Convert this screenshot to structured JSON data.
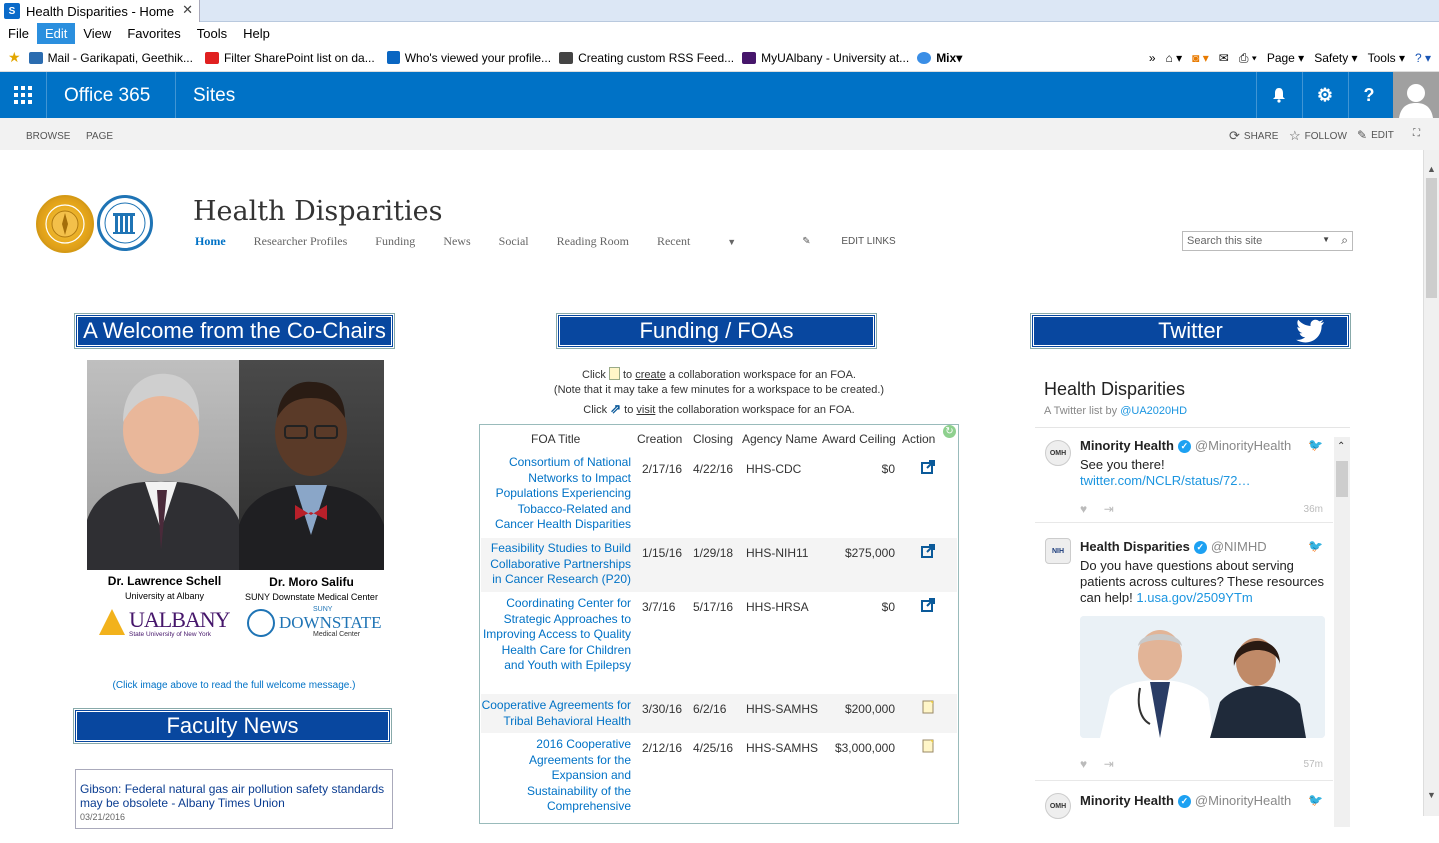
{
  "browser": {
    "tab_title": "Health Disparities - Home",
    "tab_close": "✕",
    "menu": [
      "File",
      "Edit",
      "View",
      "Favorites",
      "Tools",
      "Help"
    ],
    "favorites": [
      {
        "label": "Mail - Garikapati, Geethik...",
        "color": "#2b6cb0"
      },
      {
        "label": "Filter SharePoint list on da...",
        "color": "#e02020"
      },
      {
        "label": "Who's viewed your profile...",
        "color": "#0a66c2"
      },
      {
        "label": "Creating custom RSS Feed...",
        "color": "#444444"
      },
      {
        "label": "MyUAlbany - University at...",
        "color": "#46166b"
      },
      {
        "label": "Mix",
        "color": "#3a8ee6"
      }
    ],
    "tools": {
      "page": "Page ▾",
      "safety": "Safety ▾",
      "tools": "Tools ▾",
      "help": "? ▾"
    }
  },
  "suite": {
    "brand": "Office 365",
    "sites": "Sites"
  },
  "ribbon": {
    "browse": "BROWSE",
    "page": "PAGE",
    "share": "SHARE",
    "follow": "FOLLOW",
    "edit": "EDIT"
  },
  "site": {
    "title": "Health Disparities",
    "nav": [
      "Home",
      "Researcher Profiles",
      "Funding",
      "News",
      "Social",
      "Reading Room",
      "Recent"
    ],
    "edit_links": "EDIT LINKS",
    "search_placeholder": "Search this site"
  },
  "welcome": {
    "header": "A Welcome from the Co-Chairs",
    "person1_name": "Dr. Lawrence Schell",
    "person1_aff": "University at Albany",
    "person2_name": "Dr. Moro Salifu",
    "person2_aff": "SUNY Downstate Medical Center",
    "logo1": "UALBANY",
    "logo1_sub": "State University of New York",
    "logo2_top": "SUNY",
    "logo2": "DOWNSTATE",
    "logo2_sub": "Medical Center",
    "note": "(Click image above to read the full welcome message.)"
  },
  "faculty_news": {
    "header": "Faculty News",
    "item1": "Gibson: Federal natural gas air pollution safety standards may be obsolete - Albany Times Union",
    "item1_date": "03/21/2016"
  },
  "funding": {
    "header": "Funding / FOAs",
    "instr1_pre": "Click",
    "instr1_link": "create",
    "instr1_post": "a collaboration workspace for an FOA.",
    "instr_to": "to",
    "instr2": "(Note that it may take a few minutes for a workspace to be created.)",
    "instr3_pre": "Click",
    "instr3_link": "visit",
    "instr3_post": "the collaboration workspace for an FOA.",
    "columns": [
      "FOA Title",
      "Creation",
      "Closing",
      "Agency Name",
      "Award Ceiling",
      "Action"
    ],
    "rows": [
      {
        "title": "Consortium of National Networks to Impact Populations Experiencing Tobacco-Related and Cancer Health Disparities",
        "creation": "2/17/16",
        "closing": "4/22/16",
        "agency": "HHS-CDC",
        "award": "$0",
        "action": "visit"
      },
      {
        "title": "Feasibility Studies to Build Collaborative Partnerships in Cancer Research (P20)",
        "creation": "1/15/16",
        "closing": "1/29/18",
        "agency": "HHS-NIH11",
        "award": "$275,000",
        "action": "visit"
      },
      {
        "title": "Coordinating Center for Strategic Approaches to Improving Access to Quality Health Care for Children and Youth with Epilepsy",
        "creation": "3/7/16",
        "closing": "5/17/16",
        "agency": "HHS-HRSA",
        "award": "$0",
        "action": "visit"
      },
      {
        "title": "Cooperative Agreements for Tribal Behavioral Health",
        "creation": "3/30/16",
        "closing": "6/2/16",
        "agency": "HHS-SAMHS",
        "award": "$200,000",
        "action": "create"
      },
      {
        "title": "2016 Cooperative Agreements for the Expansion and Sustainability of the Comprehensive",
        "creation": "2/12/16",
        "closing": "4/25/16",
        "agency": "HHS-SAMHS",
        "award": "$3,000,000",
        "action": "create"
      }
    ]
  },
  "twitter": {
    "header": "Twitter",
    "list_title": "Health Disparities",
    "list_sub_pre": "A Twitter list by",
    "list_sub_handle": "@UA2020HD",
    "tweets": [
      {
        "name": "Minority Health",
        "handle": "@MinorityHealth",
        "text": "See you there!",
        "link": "twitter.com/NCLR/status/72…",
        "time": "36m",
        "avatar": "OMH"
      },
      {
        "name": "Health Disparities",
        "handle": "@NIMHD",
        "text": "Do you have questions about serving patients across cultures? These resources can help!",
        "link": "1.usa.gov/2509YTm",
        "time": "57m",
        "avatar": "NIH"
      },
      {
        "name": "Minority Health",
        "handle": "@MinorityHealth",
        "text": "",
        "link": "",
        "time": "",
        "avatar": "OMH"
      }
    ]
  }
}
